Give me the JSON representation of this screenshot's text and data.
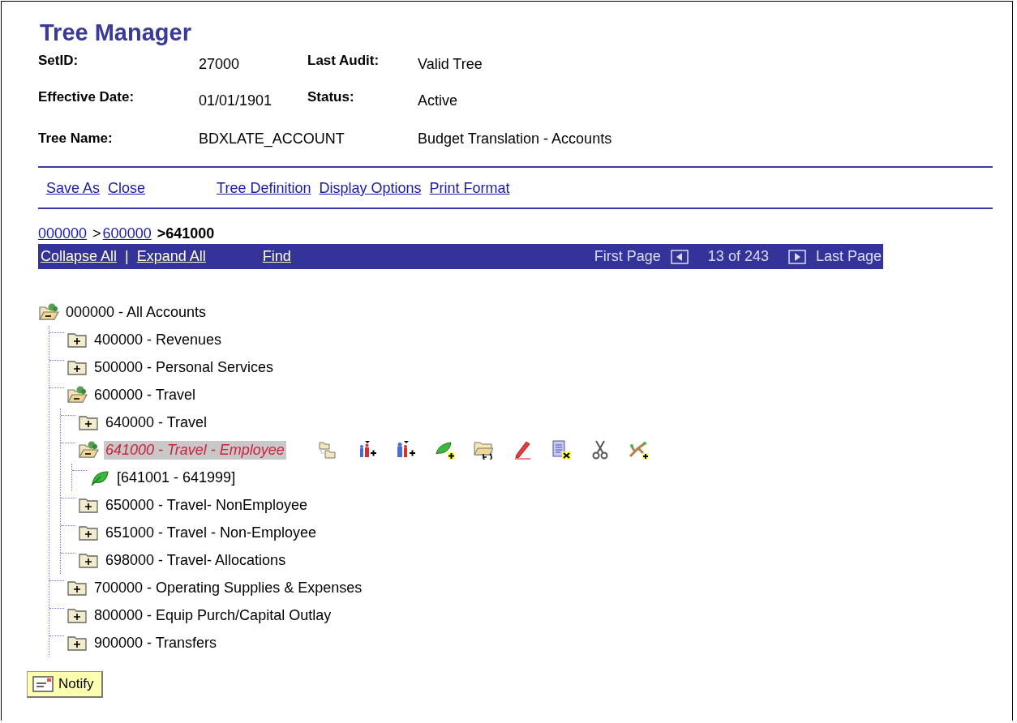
{
  "title": "Tree Manager",
  "info_rows": [
    {
      "label": "SetID:",
      "value": "27000",
      "label_2": "Last Audit:",
      "value_2": "Valid Tree"
    },
    {
      "label": "Effective Date:",
      "value": "01/01/1901",
      "label_2": "Status:",
      "value_2": "Active"
    },
    {
      "label": "Tree Name:",
      "value": "BDXLATE_ACCOUNT",
      "value_2": "Budget Translation - Accounts"
    }
  ],
  "action_links": [
    [
      "Save As",
      "Close"
    ],
    [
      "Tree Definition",
      "Display Options",
      "Print Format"
    ]
  ],
  "breadcrumb": [
    {
      "text": "000000",
      "kind": "link"
    },
    {
      "text": ">",
      "kind": "separator"
    },
    {
      "text": "600000",
      "kind": "link"
    },
    {
      "text": ">641000",
      "kind": "current"
    }
  ],
  "nav_bar": {
    "links": [
      "Collapse All",
      "Expand All",
      "Find"
    ],
    "separator": "|",
    "first_page": "First Page",
    "page_info": "13 of 243",
    "last_page": "Last Page"
  },
  "tree": [
    {
      "label": "000000 - All Accounts",
      "kind": "folder",
      "expanded": true,
      "selected": false,
      "children": [
        {
          "label": "400000 - Revenues",
          "kind": "folder",
          "expanded": false,
          "selected": false
        },
        {
          "label": "500000 - Personal Services",
          "kind": "folder",
          "expanded": false,
          "selected": false
        },
        {
          "label": "600000 - Travel",
          "kind": "folder",
          "expanded": true,
          "selected": false,
          "children": [
            {
              "label": "640000 - Travel",
              "kind": "folder",
              "expanded": false,
              "selected": false
            },
            {
              "label": "641000 - Travel - Employee",
              "kind": "folder",
              "expanded": true,
              "selected": true,
              "children": [
                {
                  "label": "[641001 - 641999]",
                  "kind": "leaf",
                  "selected": false
                }
              ]
            },
            {
              "label": "650000 - Travel- NonEmployee",
              "kind": "folder",
              "expanded": false,
              "selected": false
            },
            {
              "label": "651000 - Travel - Non-Employee",
              "kind": "folder",
              "expanded": false,
              "selected": false
            },
            {
              "label": "698000 - Travel- Allocations",
              "kind": "folder",
              "expanded": false,
              "selected": false
            }
          ]
        },
        {
          "label": "700000 - Operating Supplies & Expenses",
          "kind": "folder",
          "expanded": false,
          "selected": false
        },
        {
          "label": "800000 - Equip Purch/Capital Outlay",
          "kind": "folder",
          "expanded": false,
          "selected": false
        },
        {
          "label": "900000 - Transfers",
          "kind": "folder",
          "expanded": false,
          "selected": false
        }
      ]
    }
  ],
  "notify_button": "Notify"
}
